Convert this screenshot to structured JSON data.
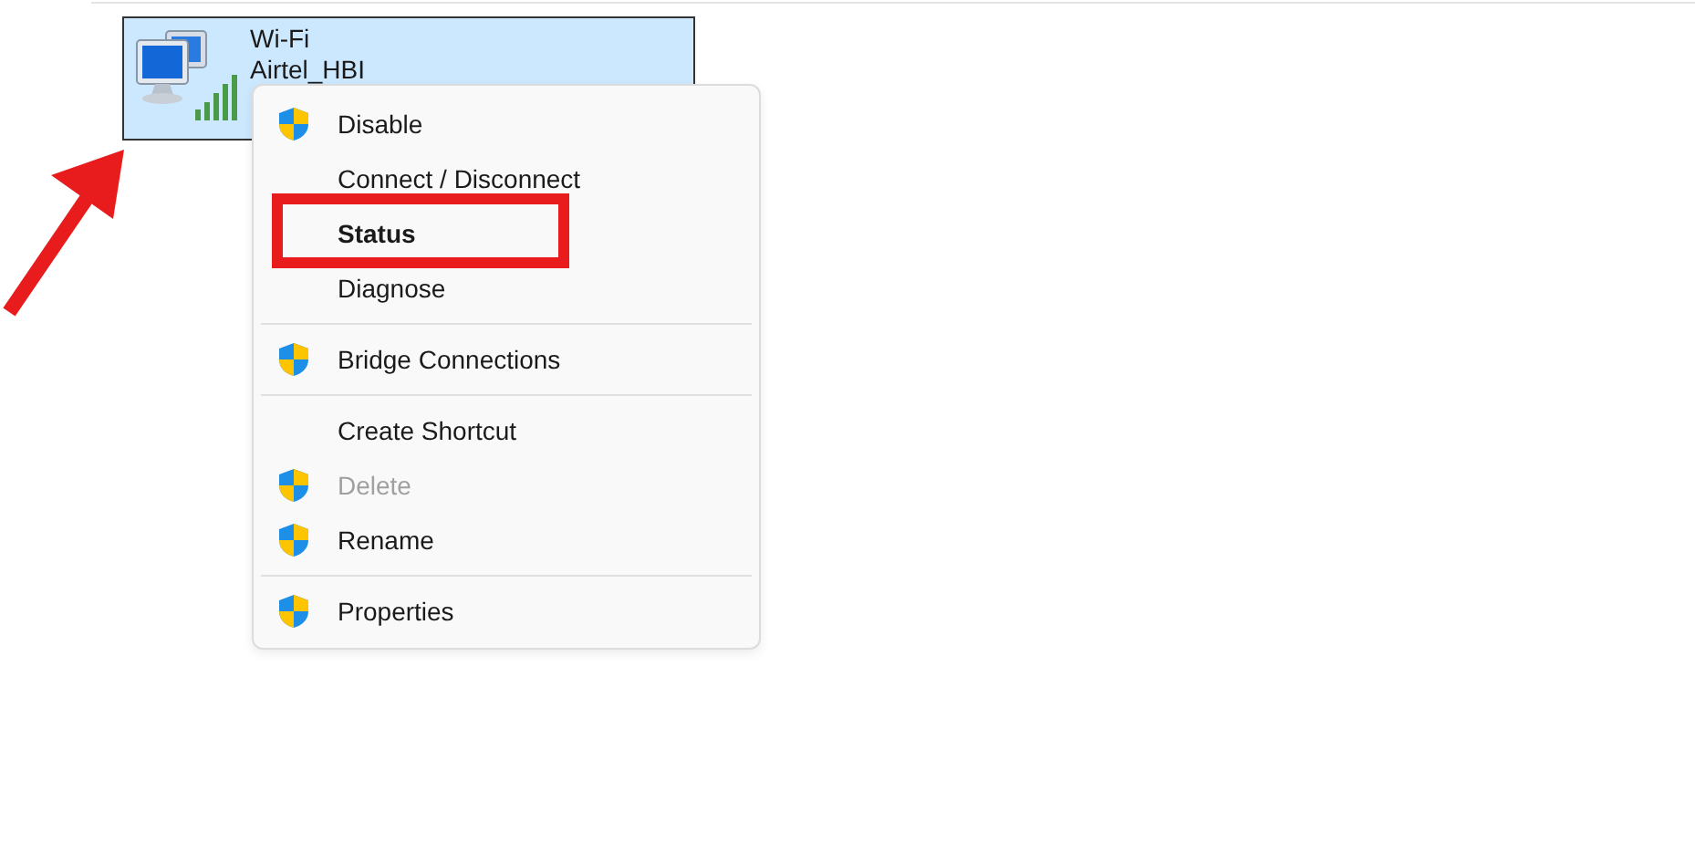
{
  "adapter": {
    "name": "Wi-Fi",
    "network": "Airtel_HBI",
    "selected": true,
    "arrow_pointed": true
  },
  "context_menu": {
    "items": [
      {
        "kind": "item",
        "label": "Disable",
        "shield": true,
        "default": false,
        "disabled": false,
        "boxed": false
      },
      {
        "kind": "item",
        "label": "Connect / Disconnect",
        "shield": false,
        "default": false,
        "disabled": false,
        "boxed": false
      },
      {
        "kind": "item",
        "label": "Status",
        "shield": false,
        "default": true,
        "disabled": false,
        "boxed": true
      },
      {
        "kind": "item",
        "label": "Diagnose",
        "shield": false,
        "default": false,
        "disabled": false,
        "boxed": false
      },
      {
        "kind": "separator"
      },
      {
        "kind": "item",
        "label": "Bridge Connections",
        "shield": true,
        "default": false,
        "disabled": false,
        "boxed": false
      },
      {
        "kind": "separator"
      },
      {
        "kind": "item",
        "label": "Create Shortcut",
        "shield": false,
        "default": false,
        "disabled": false,
        "boxed": false
      },
      {
        "kind": "item",
        "label": "Delete",
        "shield": true,
        "default": false,
        "disabled": true,
        "boxed": false
      },
      {
        "kind": "item",
        "label": "Rename",
        "shield": true,
        "default": false,
        "disabled": false,
        "boxed": false
      },
      {
        "kind": "separator"
      },
      {
        "kind": "item",
        "label": "Properties",
        "shield": true,
        "default": false,
        "disabled": false,
        "boxed": false
      }
    ]
  }
}
